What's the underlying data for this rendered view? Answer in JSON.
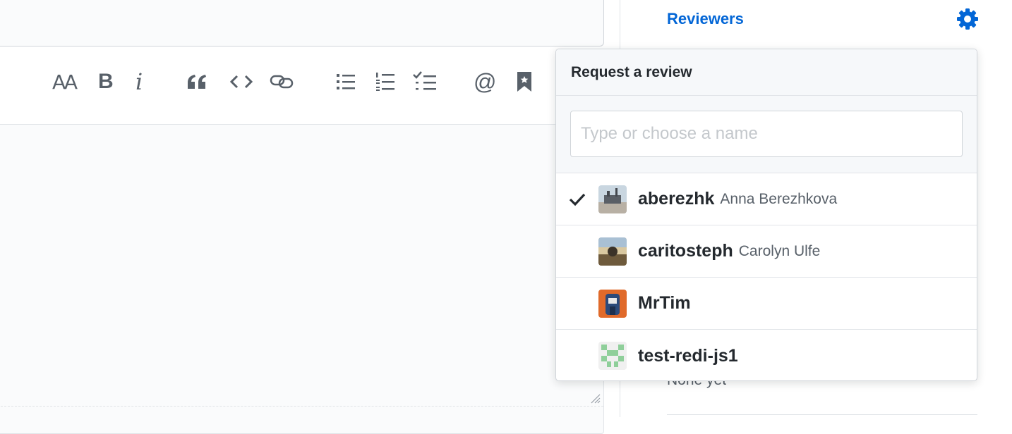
{
  "sidebar": {
    "reviewers_heading": "Reviewers",
    "none_yet": "None yet"
  },
  "toolbar": {
    "header_label": "AA",
    "bold_label": "B",
    "italic_label": "i",
    "mention_label": "@"
  },
  "popover": {
    "title": "Request a review",
    "filter_placeholder": "Type or choose a name",
    "users": [
      {
        "login": "aberezhk",
        "name": "Anna Berezhkova",
        "selected": true
      },
      {
        "login": "caritosteph",
        "name": "Carolyn Ulfe",
        "selected": false
      },
      {
        "login": "MrTim",
        "name": "",
        "selected": false
      },
      {
        "login": "test-redi-js1",
        "name": "",
        "selected": false
      }
    ]
  },
  "colors": {
    "link_blue": "#0366d6",
    "muted": "#586069",
    "border": "#d1d5da"
  }
}
